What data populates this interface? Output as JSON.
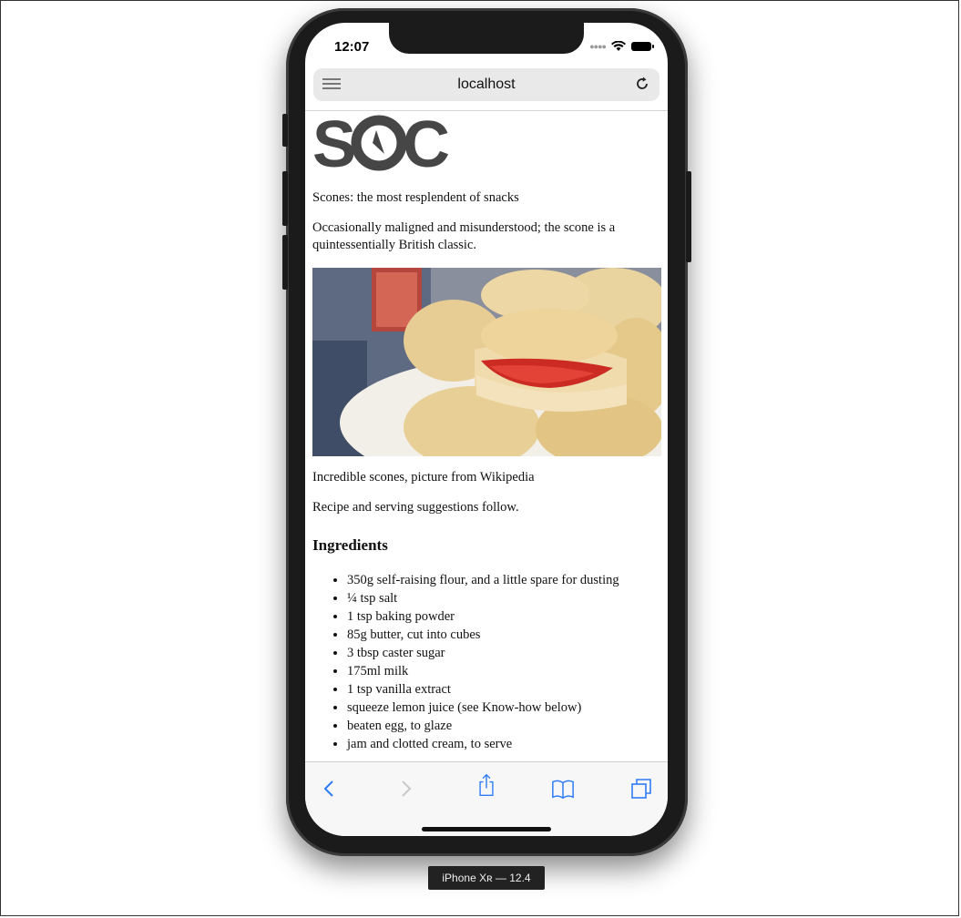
{
  "status_bar": {
    "time": "12:07"
  },
  "browser": {
    "url": "localhost"
  },
  "page": {
    "tagline": "Scones: the most resplendent of snacks",
    "intro": "Occasionally maligned and misunderstood; the scone is a quintessentially British classic.",
    "image_caption": "Incredible scones, picture from Wikipedia",
    "follow_text": "Recipe and serving suggestions follow.",
    "ingredients_heading": "Ingredients",
    "ingredients": [
      "350g self-raising flour, and a little spare for dusting",
      "¼ tsp salt",
      "1 tsp baking powder",
      "85g butter, cut into cubes",
      "3 tbsp caster sugar",
      "175ml milk",
      "1 tsp vanilla extract",
      "squeeze lemon juice (see Know-how below)",
      "beaten egg, to glaze",
      "jam and clotted cream, to serve"
    ]
  },
  "logo": {
    "text": "SOC",
    "color": "#464646"
  },
  "toolbar": {
    "icons": [
      "back-icon",
      "forward-icon",
      "share-icon",
      "bookmarks-icon",
      "tabs-icon"
    ],
    "accent": "#2f7cf6"
  },
  "device_label": "iPhone Xʀ — 12.4"
}
